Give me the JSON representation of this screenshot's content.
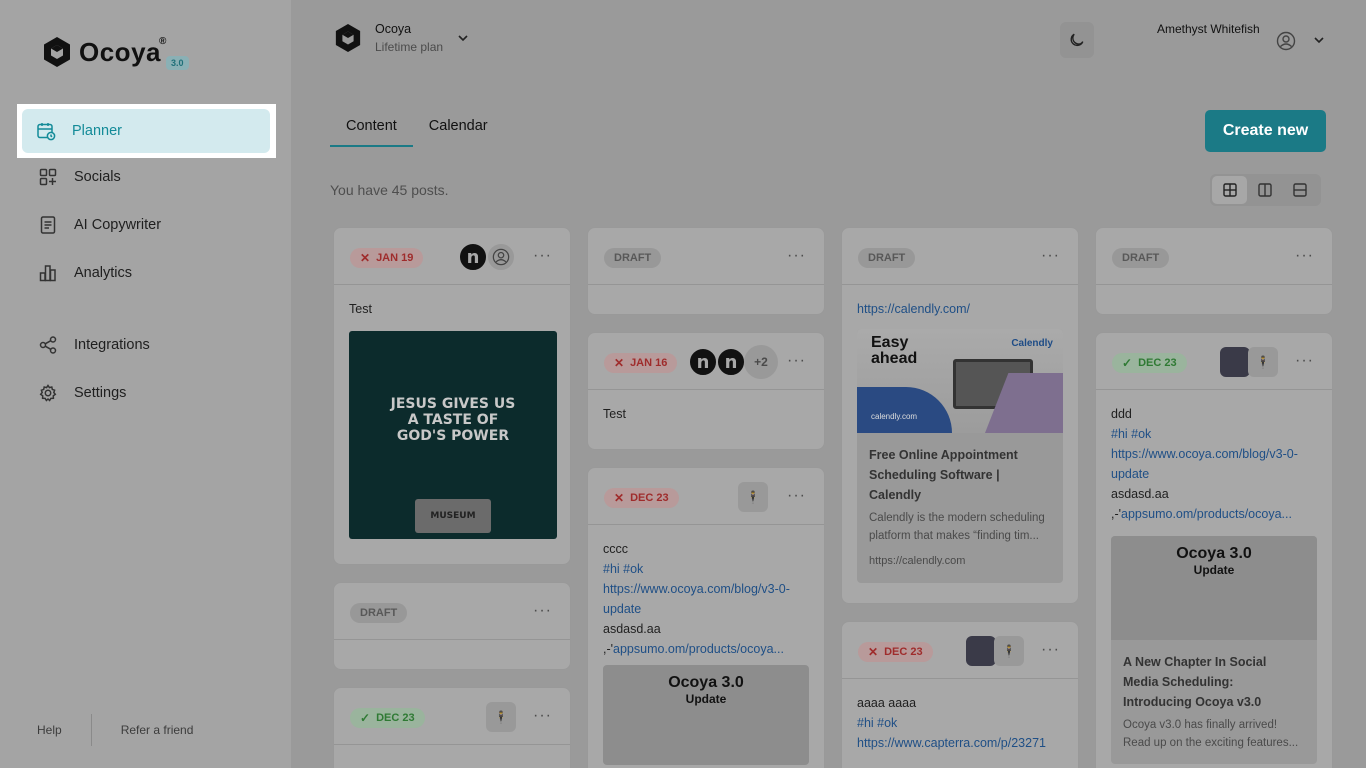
{
  "app": {
    "name": "Ocoya",
    "version": "3.0"
  },
  "sidebar": {
    "items": [
      {
        "label": "Planner",
        "icon": "calendar-clock-icon"
      },
      {
        "label": "Socials",
        "icon": "grid-plus-icon"
      },
      {
        "label": "AI Copywriter",
        "icon": "document-icon"
      },
      {
        "label": "Analytics",
        "icon": "bar-chart-icon"
      },
      {
        "label": "Integrations",
        "icon": "share-nodes-icon"
      },
      {
        "label": "Settings",
        "icon": "gear-icon"
      }
    ],
    "footer": {
      "help": "Help",
      "refer": "Refer a friend"
    }
  },
  "header": {
    "org_name": "Ocoya",
    "org_plan": "Lifetime plan",
    "user_name": "Amethyst Whitefish"
  },
  "tabs": [
    {
      "label": "Content"
    },
    {
      "label": "Calendar"
    }
  ],
  "create_label": "Create new",
  "posts_count": "You have 45 posts.",
  "cards": {
    "c1": {
      "date": "JAN 19",
      "text": "Test",
      "image_text": "JESUS GIVES US A TASTE OF GOD'S POWER",
      "image_sub": "MUSEUM"
    },
    "c2": {
      "status": "DRAFT"
    },
    "c3": {
      "date": "DEC 23"
    },
    "c4": {
      "status": "DRAFT"
    },
    "c5": {
      "date": "JAN 16",
      "more": "+2",
      "text": "Test"
    },
    "c6": {
      "date": "DEC 23",
      "line1": "cccc",
      "tags": "#hi #ok",
      "link": "https://www.ocoya.com/blog/v3-0-update",
      "line2": "asdasd.aa",
      "prefix": ",-'",
      "link2": "appsumo.om/products/ocoya...",
      "img_title": "Ocoya 3.0",
      "img_sub": "Update"
    },
    "c7": {
      "status": "DRAFT",
      "link": "https://calendly.com/",
      "img_title": "Easy ahead",
      "img_brand": "Calendly",
      "img_url": "calendly.com",
      "title": "Free Online Appointment Scheduling Software | Calendly",
      "desc": "Calendly is the modern scheduling platform that makes “finding tim...",
      "url": "https://calendly.com"
    },
    "c8": {
      "date": "DEC 23",
      "line1": "aaaa aaaa",
      "tags": "#hi #ok",
      "link": "https://www.capterra.com/p/23271"
    },
    "c9": {
      "status": "DRAFT"
    },
    "c10": {
      "date": "DEC 23",
      "line1": "ddd",
      "tags": "#hi #ok",
      "link": "https://www.ocoya.com/blog/v3-0-update",
      "line2": "asdasd.aa",
      "prefix": ",-'",
      "link2": "appsumo.om/products/ocoya...",
      "img_title": "Ocoya 3.0",
      "img_sub": "Update",
      "title": "A New Chapter In Social Media Scheduling: Introducing Ocoya v3.0",
      "desc": "Ocoya v3.0 has finally arrived! Read up on the exciting features..."
    }
  }
}
